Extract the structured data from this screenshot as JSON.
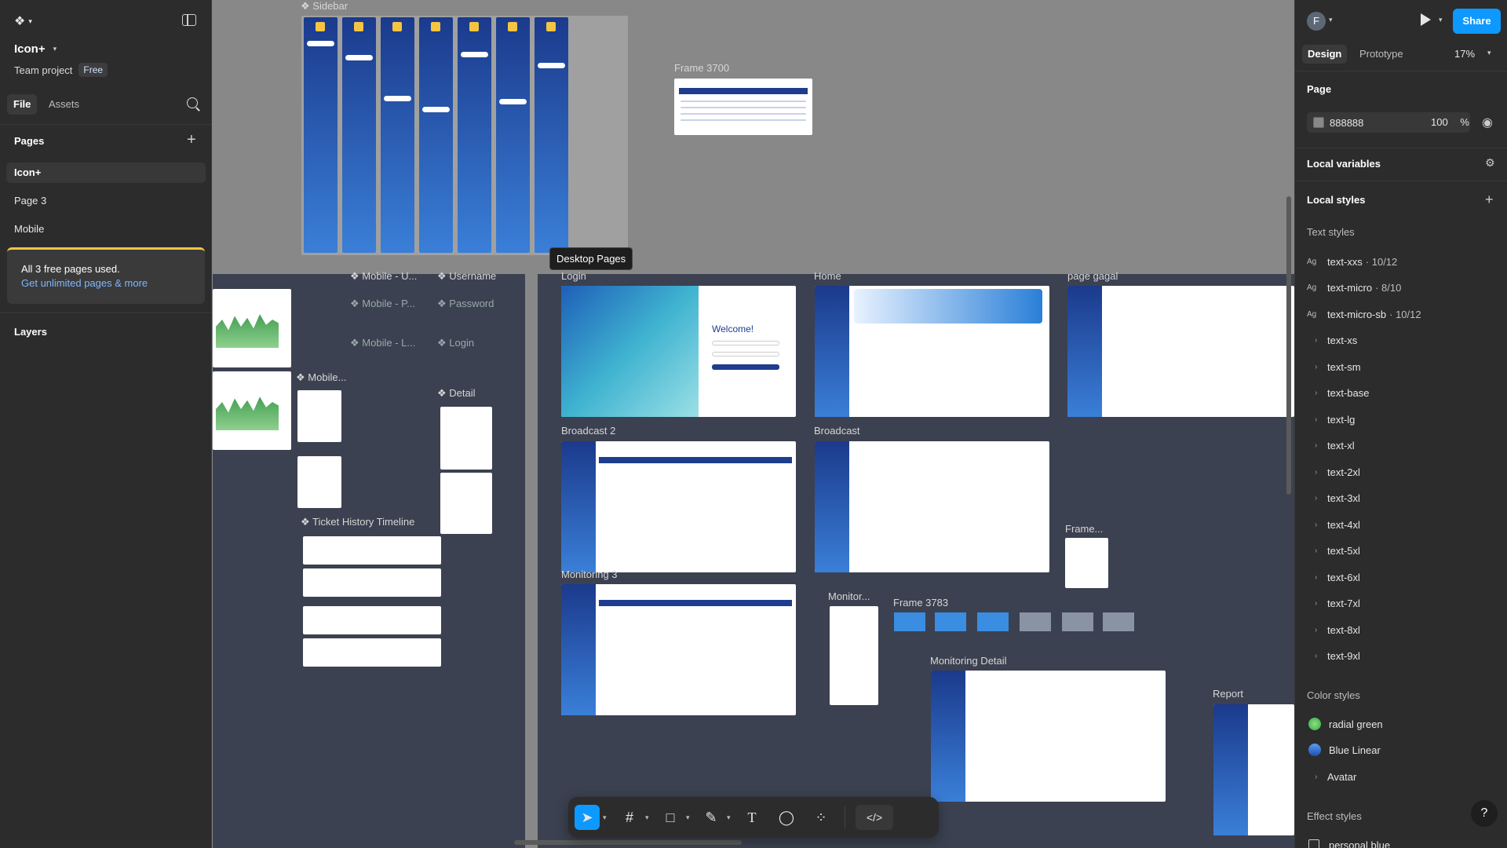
{
  "left": {
    "file_name": "Icon+",
    "team": "Team project",
    "plan": "Free",
    "tabs": [
      "File",
      "Assets"
    ],
    "pages_title": "Pages",
    "pages": [
      "Icon+",
      "Page 3",
      "Mobile"
    ],
    "upgrade_text": "All 3 free pages used.",
    "upgrade_link": "Get unlimited pages & more",
    "layers_title": "Layers"
  },
  "canvas": {
    "tooltip": "Desktop Pages",
    "frames": {
      "sidebar": "Sidebar",
      "frame3700": "Frame 3700",
      "mobile_u": "Mobile - U...",
      "username": "Username",
      "mobile_p": "Mobile - P...",
      "password": "Password",
      "mobile_l": "Mobile - L...",
      "login_small": "Login",
      "mobile": "Mobile...",
      "detail": "Detail",
      "ticket_history": "Ticket History Timeline",
      "login": "Login",
      "home": "Home",
      "page_gagal": "page gagal",
      "broadcast2": "Broadcast 2",
      "broadcast": "Broadcast",
      "frame_dots": "Frame...",
      "monitoring3": "Monitoring 3",
      "monitor": "Monitor...",
      "frame3783": "Frame 3783",
      "monitoring_detail": "Monitoring Detail",
      "report": "Report",
      "welcome": "Welcome!"
    }
  },
  "toolbar": {
    "icons": [
      "move-tool",
      "frame-tool",
      "shape-tool",
      "pen-tool",
      "text-tool",
      "comment-tool",
      "actions-tool",
      "dev-mode-toggle"
    ]
  },
  "right": {
    "avatar_letter": "F",
    "share": "Share",
    "tabs": [
      "Design",
      "Prototype"
    ],
    "zoom": "17%",
    "page_title": "Page",
    "page_color": "888888",
    "page_opacity": "100",
    "percent": "%",
    "local_variables": "Local variables",
    "local_styles": "Local styles",
    "text_styles_title": "Text styles",
    "text_styles": [
      {
        "name": "text-xxs",
        "meta": "· 10/12",
        "ag": true
      },
      {
        "name": "text-micro",
        "meta": "· 8/10",
        "ag": true
      },
      {
        "name": "text-micro-sb",
        "meta": "· 10/12",
        "ag": true
      },
      {
        "name": "text-xs",
        "meta": "",
        "ag": false
      },
      {
        "name": "text-sm",
        "meta": "",
        "ag": false
      },
      {
        "name": "text-base",
        "meta": "",
        "ag": false
      },
      {
        "name": "text-lg",
        "meta": "",
        "ag": false
      },
      {
        "name": "text-xl",
        "meta": "",
        "ag": false
      },
      {
        "name": "text-2xl",
        "meta": "",
        "ag": false
      },
      {
        "name": "text-3xl",
        "meta": "",
        "ag": false
      },
      {
        "name": "text-4xl",
        "meta": "",
        "ag": false
      },
      {
        "name": "text-5xl",
        "meta": "",
        "ag": false
      },
      {
        "name": "text-6xl",
        "meta": "",
        "ag": false
      },
      {
        "name": "text-7xl",
        "meta": "",
        "ag": false
      },
      {
        "name": "text-8xl",
        "meta": "",
        "ag": false
      },
      {
        "name": "text-9xl",
        "meta": "",
        "ag": false
      }
    ],
    "color_styles_title": "Color styles",
    "color_styles": [
      {
        "name": "radial green",
        "color": "#2fa84f"
      },
      {
        "name": "Blue Linear",
        "color": "#2d6fd6"
      },
      {
        "name": "Avatar",
        "color": ""
      }
    ],
    "effect_styles_title": "Effect styles",
    "effect_styles": [
      "personal blue"
    ],
    "help": "?"
  },
  "colors": {
    "accent": "#0d99ff",
    "canvas_bg": "#888888",
    "panel_bg": "#2c2c2c"
  }
}
